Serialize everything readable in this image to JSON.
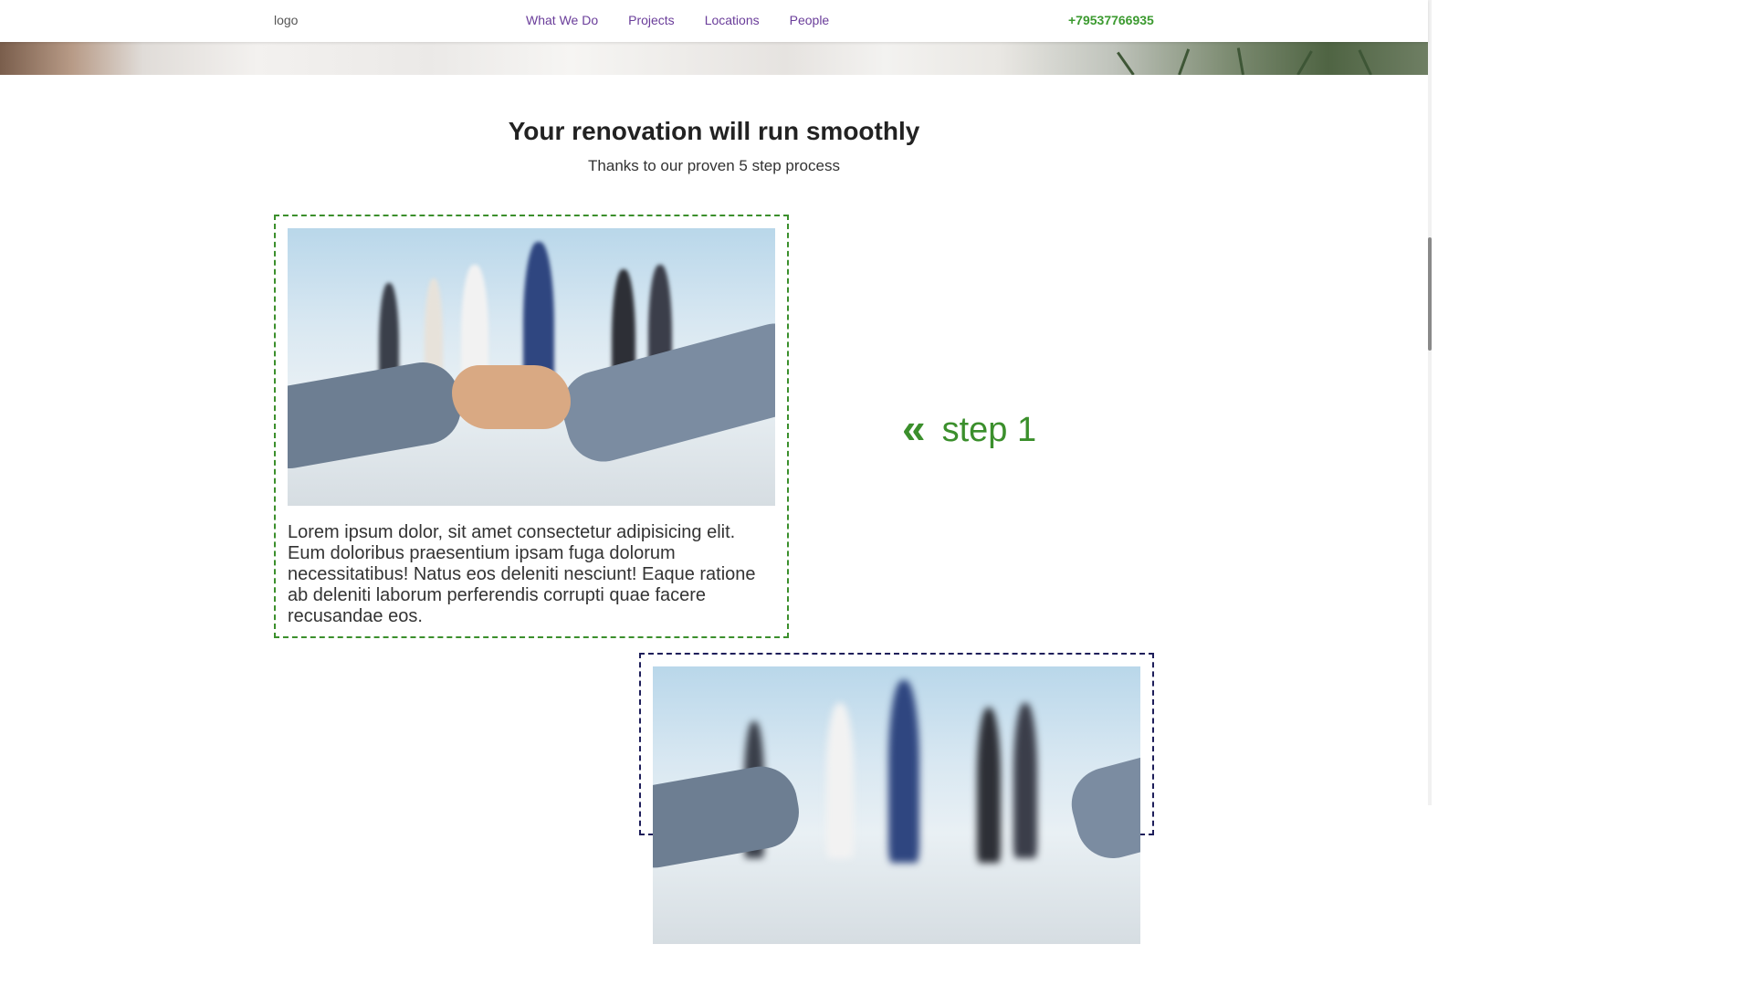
{
  "header": {
    "logo": "logo",
    "nav": [
      "What We Do",
      "Projects",
      "Locations",
      "People"
    ],
    "phone": "+79537766935"
  },
  "section": {
    "title": "Your renovation will run smoothly",
    "subtitle": "Thanks to our proven 5 step process"
  },
  "steps": [
    {
      "label": "step 1",
      "arrow": "«",
      "text": "Lorem ipsum dolor, sit amet consectetur adipisicing elit. Eum doloribus praesentium ipsam fuga dolorum necessitatibus! Natus eos deleniti nesciunt! Eaque ratione ab deleniti laborum perferendis corrupti quae facere recusandae eos.",
      "border_color": "#3b8f2c"
    },
    {
      "border_color": "#1e1e5a"
    }
  ],
  "colors": {
    "nav": "#6a3d9a",
    "accent_green": "#3b9a2f",
    "heading": "#222222"
  },
  "icons": {
    "step_arrow": "double-chevron-left-icon",
    "photo": "handshake-photo"
  }
}
